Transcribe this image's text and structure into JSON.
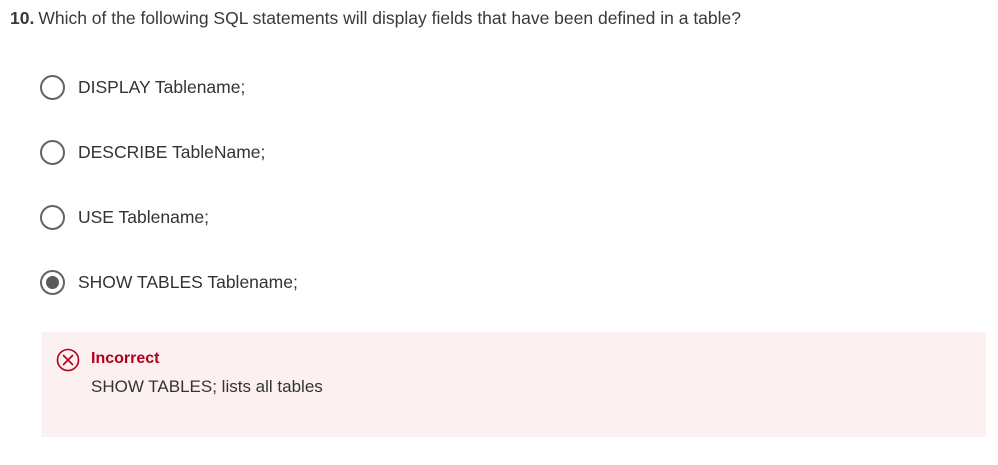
{
  "question": {
    "number": "10.",
    "text": "Which of the following SQL statements will display fields that have been defined in a table?"
  },
  "options": [
    {
      "label": "DISPLAY Tablename;",
      "selected": false
    },
    {
      "label": "DESCRIBE TableName;",
      "selected": false
    },
    {
      "label": "USE Tablename;",
      "selected": false
    },
    {
      "label": "SHOW TABLES Tablename;",
      "selected": true
    }
  ],
  "feedback": {
    "status": "Incorrect",
    "explanation": "SHOW TABLES; lists all tables",
    "icon": "x-circle-icon",
    "status_color": "#b00020",
    "background_color": "#fdf0f0"
  }
}
